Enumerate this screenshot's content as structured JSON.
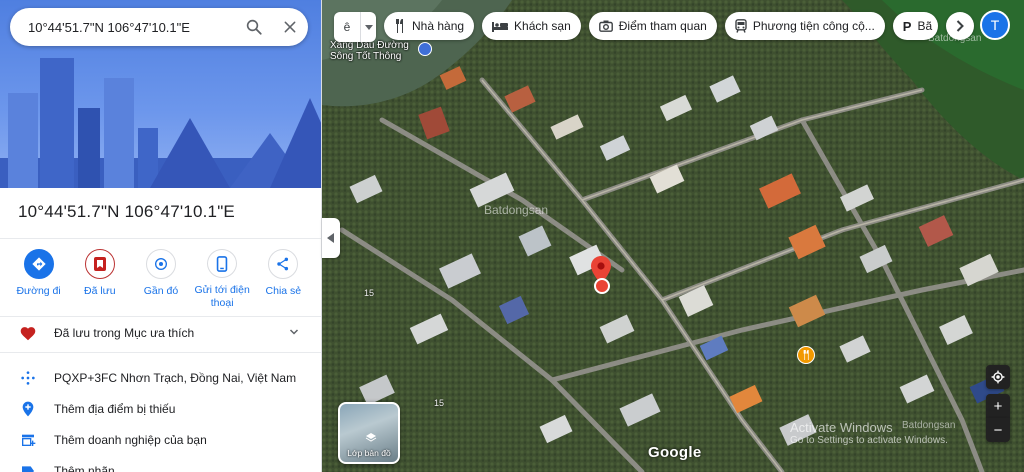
{
  "search": {
    "value": "10°44'51.7\"N 106°47'10.1\"E"
  },
  "place": {
    "title": "10°44'51.7\"N 106°47'10.1\"E"
  },
  "actions": [
    {
      "label": "Đường đi",
      "icon": "directions-icon"
    },
    {
      "label": "Đã lưu",
      "icon": "bookmark-icon"
    },
    {
      "label": "Gần đó",
      "icon": "nearby-icon"
    },
    {
      "label": "Gửi tới điện thoại",
      "icon": "phone-icon"
    },
    {
      "label": "Chia sẻ",
      "icon": "share-icon"
    }
  ],
  "saved_row": {
    "label": "Đã lưu trong Mục ưa thích"
  },
  "info_rows": [
    {
      "label": "PQXP+3FC Nhơn Trạch, Đồng Nai, Việt Nam",
      "icon": "plus-code-icon"
    },
    {
      "label": "Thêm địa điểm bị thiếu",
      "icon": "add-place-icon"
    },
    {
      "label": "Thêm doanh nghiệp của bạn",
      "icon": "add-business-icon"
    },
    {
      "label": "Thêm nhãn",
      "icon": "label-icon"
    }
  ],
  "map": {
    "layer_pill": "ê",
    "chips": [
      {
        "label": "Nhà hàng",
        "icon": "restaurant-icon"
      },
      {
        "label": "Khách sạn",
        "icon": "hotel-icon"
      },
      {
        "label": "Điểm tham quan",
        "icon": "camera-icon"
      },
      {
        "label": "Phương tiện công cộ...",
        "icon": "transit-icon"
      },
      {
        "label": "Bã",
        "icon": "parking-icon"
      }
    ],
    "avatar_letter": "T",
    "poi_label_line1": "Xăng Dầu Đường",
    "poi_label_line2": "Sông Tốt Thông",
    "road_label_1": "15",
    "road_label_2": "15",
    "layers_label": "Lớp bản đồ",
    "zoom_in": "+",
    "zoom_out": "−",
    "logo": "Google",
    "watermark_center": "Batdongsan",
    "watermark_top": "Batdongsan",
    "watermark_bottom": "Batdongsan",
    "windows_line1": "Activate Windows",
    "windows_line2": "Go to Settings to activate Windows."
  },
  "colors": {
    "accent": "#1a73e8",
    "pin": "#ea4335",
    "heart": "#c5221f",
    "food": "#f29900"
  }
}
